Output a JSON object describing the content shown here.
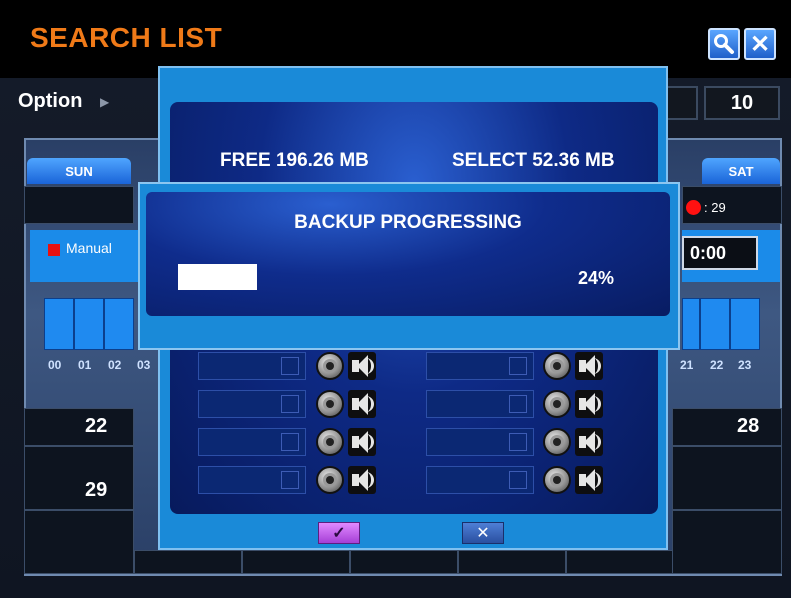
{
  "window": {
    "title": "SEARCH LIST"
  },
  "toolbar": {
    "search_icon": "search-icon",
    "close_icon": "close-icon",
    "close_glyph": "✕"
  },
  "option_bar": {
    "label": "Option",
    "day_value": "10"
  },
  "calendar": {
    "weekday_left": "SUN",
    "weekday_right": "SAT",
    "event_count": ": 29",
    "manual_label": "Manual",
    "time_value": "0:00",
    "hours_left": [
      "00",
      "01",
      "02",
      "03"
    ],
    "hours_right": [
      "21",
      "22",
      "23"
    ],
    "dates": [
      "22",
      "28",
      "29"
    ]
  },
  "backup": {
    "free_label": "FREE 196.26 MB",
    "select_label": "SELECT 52.36 MB",
    "confirm_glyph": "✓",
    "cancel_glyph": "✕"
  },
  "progress": {
    "title": "BACKUP PROGRESSING",
    "percent_text": "24%",
    "fraction": 0.24
  },
  "colors": {
    "title_orange": "#f07a18",
    "dialog_blue": "#1a8ad8",
    "record_red": "#ff1111"
  }
}
